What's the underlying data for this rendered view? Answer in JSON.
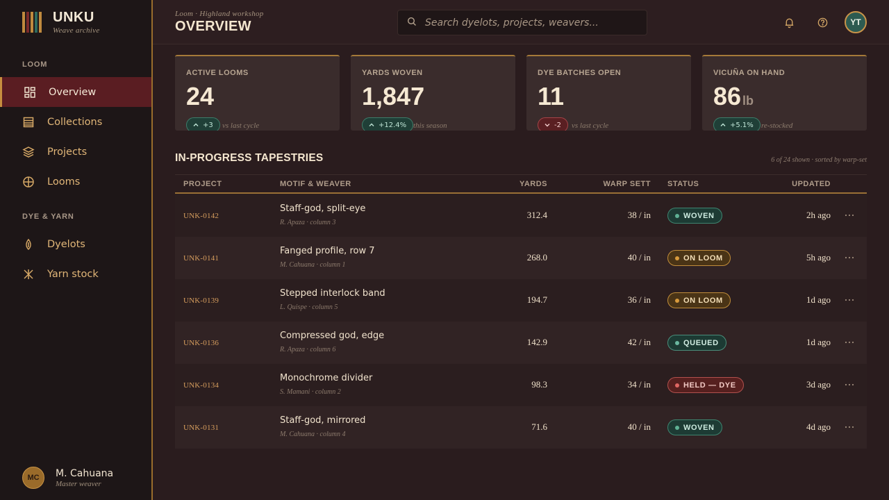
{
  "brand": {
    "name": "UNKU",
    "subtitle": "Weave archive",
    "logo_colors": [
      "#c08a3e",
      "#7a2a2a",
      "#c08a3e",
      "#2f6b5e",
      "#c08a3e"
    ]
  },
  "sidebar": {
    "sections": [
      {
        "label": "LOOM"
      },
      {
        "label": "DYE & YARN"
      }
    ],
    "items": [
      {
        "label": "Overview",
        "icon": "grid-icon",
        "active": true
      },
      {
        "label": "Collections",
        "icon": "list-icon"
      },
      {
        "label": "Projects",
        "icon": "layers-icon"
      },
      {
        "label": "Looms",
        "icon": "loom-circle-icon"
      },
      {
        "label": "Dyelots",
        "icon": "drop-icon"
      },
      {
        "label": "Yarn stock",
        "icon": "spindle-icon"
      }
    ]
  },
  "user": {
    "initials": "MC",
    "name": "M. Cahuana",
    "role": "Master weaver"
  },
  "header": {
    "breadcrumb": "Loom · Highland workshop",
    "title": "OVERVIEW",
    "search_placeholder": "Search dyelots, projects, weavers...",
    "avatar_initials": "YT"
  },
  "stats": [
    {
      "label": "ACTIVE LOOMS",
      "value": "24",
      "unit": "",
      "delta": "+3",
      "direction": "up",
      "note": "vs last cycle"
    },
    {
      "label": "YARDS WOVEN",
      "value": "1,847",
      "unit": "",
      "delta": "+12.4%",
      "direction": "up",
      "note": "this season"
    },
    {
      "label": "DYE BATCHES OPEN",
      "value": "11",
      "unit": "",
      "delta": "-2",
      "direction": "down",
      "note": "vs last cycle"
    },
    {
      "label": "VICUÑA ON HAND",
      "value": "86",
      "unit": "lb",
      "delta": "+5.1%",
      "direction": "up",
      "note": "re-stocked"
    }
  ],
  "table": {
    "title": "IN-PROGRESS TAPESTRIES",
    "meta": "6 of 24 shown · sorted by warp-set",
    "columns": [
      "PROJECT",
      "MOTIF & WEAVER",
      "YARDS",
      "WARP SETT",
      "STATUS",
      "UPDATED"
    ],
    "rows": [
      {
        "id": "UNK-0142",
        "motif": "Staff-god, split-eye",
        "weaver": "R. Apaza · column 3",
        "yards": "312.4",
        "sett": "38 / in",
        "status": "WOVEN",
        "status_kind": "woven",
        "updated": "2h ago"
      },
      {
        "id": "UNK-0141",
        "motif": "Fanged profile, row 7",
        "weaver": "M. Cahuana · column 1",
        "yards": "268.0",
        "sett": "40 / in",
        "status": "ON LOOM",
        "status_kind": "onloom",
        "updated": "5h ago"
      },
      {
        "id": "UNK-0139",
        "motif": "Stepped interlock band",
        "weaver": "L. Quispe · column 5",
        "yards": "194.7",
        "sett": "36 / in",
        "status": "ON LOOM",
        "status_kind": "onloom",
        "updated": "1d ago"
      },
      {
        "id": "UNK-0136",
        "motif": "Compressed god, edge",
        "weaver": "R. Apaza · column 6",
        "yards": "142.9",
        "sett": "42 / in",
        "status": "QUEUED",
        "status_kind": "queued",
        "updated": "1d ago"
      },
      {
        "id": "UNK-0134",
        "motif": "Monochrome divider",
        "weaver": "S. Mamani · column 2",
        "yards": "98.3",
        "sett": "34 / in",
        "status": "HELD — DYE",
        "status_kind": "held",
        "updated": "3d ago"
      },
      {
        "id": "UNK-0131",
        "motif": "Staff-god, mirrored",
        "weaver": "M. Cahuana · column 4",
        "yards": "71.6",
        "sett": "40 / in",
        "status": "WOVEN",
        "status_kind": "woven",
        "updated": "4d ago"
      }
    ]
  }
}
